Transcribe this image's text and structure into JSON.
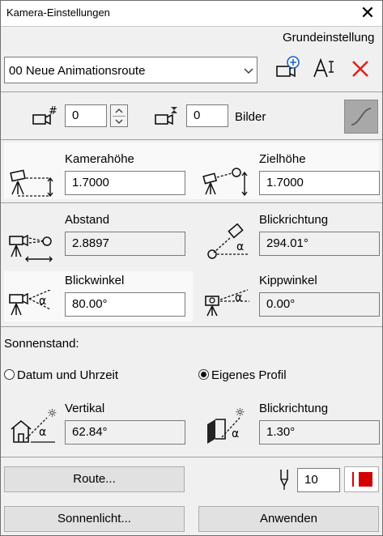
{
  "window": {
    "title": "Kamera-Einstellungen"
  },
  "header": {
    "preset_label": "Grundeinstellung"
  },
  "route": {
    "selected": "00  Neue Animationsroute"
  },
  "frames": {
    "camera_count": "0",
    "images_count": "0",
    "images_label": "Bilder"
  },
  "height": {
    "camera_label": "Kamerahöhe",
    "camera_value": "1.7000",
    "target_label": "Zielhöhe",
    "target_value": "1.7000"
  },
  "view": {
    "distance_label": "Abstand",
    "distance_value": "2.8897",
    "direction_label": "Blickrichtung",
    "direction_value": "294.01°",
    "angle_label": "Blickwinkel",
    "angle_value": "80.00°",
    "tilt_label": "Kippwinkel",
    "tilt_value": "0.00°"
  },
  "sun": {
    "section_label": "Sonnenstand:",
    "option_datetime": "Datum und Uhrzeit",
    "option_profile": "Eigenes Profil",
    "selected_option": "profile",
    "vertical_label": "Vertikal",
    "vertical_value": "62.84°",
    "direction_label": "Blickrichtung",
    "direction_value": "1.30°"
  },
  "footer": {
    "route_button": "Route...",
    "pen_value": "10",
    "sunlight_button": "Sonnenlicht...",
    "apply_button": "Anwenden"
  },
  "colors": {
    "delete_red": "#e0201f",
    "stop_red": "#d40000",
    "accent_blue": "#1a5fd0"
  }
}
